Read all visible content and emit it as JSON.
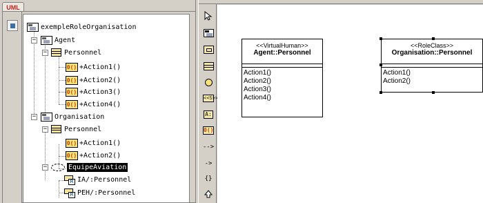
{
  "tab": {
    "label": "UML"
  },
  "tree": {
    "root": "exempleRoleOrganisation",
    "agent": {
      "label": "Agent",
      "class_label": "Personnel",
      "ops": [
        "+Action1()",
        "+Action2()",
        "+Action3()",
        "+Action4()"
      ]
    },
    "organisation": {
      "label": "Organisation",
      "class_label": "Personnel",
      "ops": [
        "+Action1()",
        "+Action2()"
      ],
      "collab_label": "EquipeAviation",
      "roles": [
        "IA/:Personnel",
        "PEH/:Personnel"
      ]
    },
    "op_icon_text": "0()",
    "role_icon_text": "R"
  },
  "toolbar": {
    "tools": [
      "select-pointer",
      "package",
      "subsystem",
      "class",
      "interface",
      "stereotype",
      "attribute",
      "operation",
      "generalization",
      "association",
      "dependency",
      "realization"
    ],
    "stereo_text": "<<S>>",
    "attr_text": "A:",
    "op_text": "0()",
    "dep_text": "{}",
    "gen_text": "-->",
    "assoc_text": "->"
  },
  "diagram": {
    "class1": {
      "stereotype": "<<VirtualHuman>>",
      "name": "Agent::Personnel",
      "ops": [
        "Action1()",
        "Action2()",
        "Action3()",
        "Action4()"
      ]
    },
    "class2": {
      "stereotype": "<<RoleClass>>",
      "name": "Organisation::Personnel",
      "ops": [
        "Action1()",
        "Action2()"
      ]
    }
  }
}
